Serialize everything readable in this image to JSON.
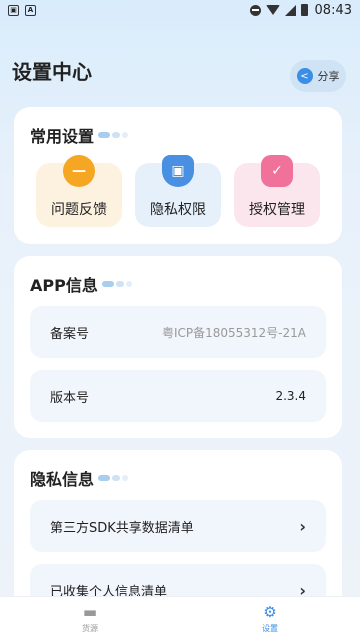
{
  "status": {
    "time": "08:43",
    "left_icons": [
      "image-notification-icon",
      "a-notification-icon"
    ]
  },
  "page": {
    "title": "设置中心"
  },
  "share": {
    "label": "分享"
  },
  "common": {
    "title": "常用设置",
    "tiles": [
      {
        "label": "问题反馈",
        "icon": "feedback-icon",
        "color": "#f5a623",
        "bg": "#fdf2e0"
      },
      {
        "label": "隐私权限",
        "icon": "shield-icon",
        "color": "#4a90e2",
        "bg": "#e6f0fb"
      },
      {
        "label": "授权管理",
        "icon": "authorize-icon",
        "color": "#f0719a",
        "bg": "#fce6ee"
      }
    ]
  },
  "app": {
    "title": "APP信息",
    "rows": [
      {
        "label": "备案号",
        "value": "粤ICP备18055312号-21A"
      },
      {
        "label": "版本号",
        "value": "2.3.4"
      }
    ]
  },
  "privacy": {
    "title": "隐私信息",
    "rows": [
      {
        "label": "第三方SDK共享数据清单"
      },
      {
        "label": "已收集个人信息清单"
      }
    ]
  },
  "tabbar": {
    "tabs": [
      {
        "label": "货源",
        "icon": "truck-icon"
      },
      {
        "label": "设置",
        "icon": "gear-icon"
      }
    ]
  }
}
